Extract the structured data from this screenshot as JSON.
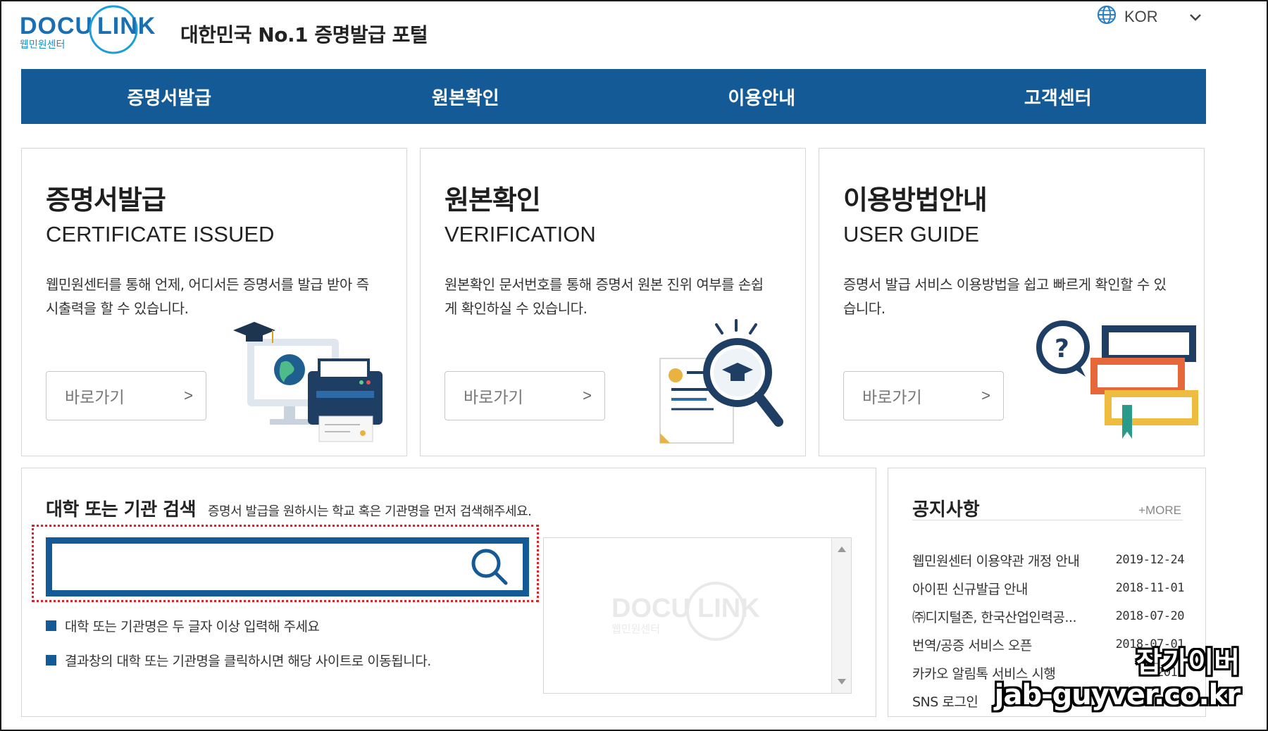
{
  "header": {
    "logo_text": "DOCU LINK",
    "logo_sub": "웹민원센터",
    "tagline": "대한민국 No.1 증명발급 포털",
    "language": "KOR"
  },
  "nav": {
    "items": [
      {
        "label": "증명서발급"
      },
      {
        "label": "원본확인"
      },
      {
        "label": "이용안내"
      },
      {
        "label": "고객센터"
      }
    ]
  },
  "cards": [
    {
      "title": "증명서발급",
      "subtitle": "CERTIFICATE ISSUED",
      "description": "웹민원센터를 통해 언제, 어디서든 증명서를 발급 받아 즉시출력을 할 수 있습니다.",
      "button": "바로가기",
      "arrow": ">"
    },
    {
      "title": "원본확인",
      "subtitle": "VERIFICATION",
      "description": "원본확인 문서번호를 통해 증명서 원본 진위 여부를 손쉽게 확인하실 수 있습니다.",
      "button": "바로가기",
      "arrow": ">"
    },
    {
      "title": "이용방법안내",
      "subtitle": "USER GUIDE",
      "description": "증명서 발급 서비스 이용방법을 쉽고 빠르게 확인할 수 있습니다.",
      "button": "바로가기",
      "arrow": ">"
    }
  ],
  "search": {
    "title": "대학 또는 기관 검색",
    "hint": "증명서 발급을 원하시는 학교 혹은 기관명을 먼저 검색해주세요.",
    "value": "",
    "placeholder": "",
    "bullets": [
      "대학 또는 기관명은 두 글자 이상 입력해 주세요",
      "결과창의 대학 또는 기관명을 클릭하시면 해당 사이트로 이동됩니다."
    ]
  },
  "notice": {
    "title": "공지사항",
    "more": "+MORE",
    "items": [
      {
        "title": "웹민원센터 이용약관 개정 안내",
        "date": "2019-12-24"
      },
      {
        "title": "아이핀 신규발급 안내",
        "date": "2018-11-01"
      },
      {
        "title": "㈜디지털존, 한국산업인력공...",
        "date": "2018-07-20"
      },
      {
        "title": "번역/공증 서비스 오픈",
        "date": "2018-07-01"
      },
      {
        "title": "카카오 알림톡 서비스 시행",
        "date": "2017"
      },
      {
        "title": "SNS 로그인",
        "date": ""
      }
    ]
  },
  "overlay": {
    "line1": "잡가이버",
    "line2": "jab-guyver.co.kr"
  },
  "colors": {
    "brand_blue": "#145a96",
    "logo_blue": "#1a8fc8",
    "highlight_red": "#d8242c"
  },
  "icons": [
    "globe-icon",
    "chevron-down-icon",
    "search-icon",
    "chevron-right-icon",
    "computer-printer-illustration",
    "certificate-magnifier-illustration",
    "question-books-illustration"
  ]
}
